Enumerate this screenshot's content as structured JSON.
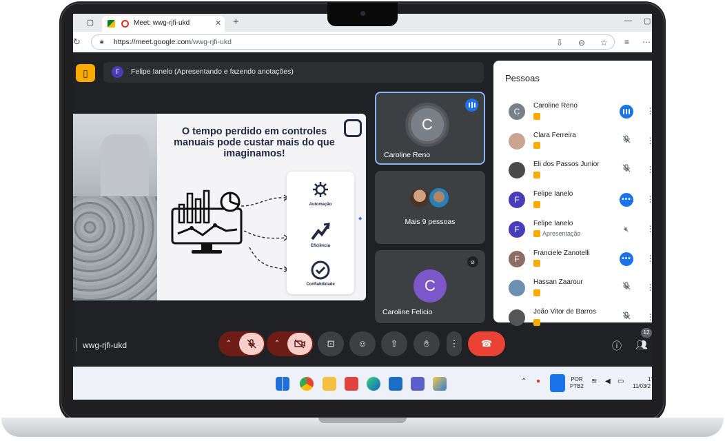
{
  "browser": {
    "tab_title": "Meet: wwg-rjfi-ukd",
    "url_host": "https://meet.google.com",
    "url_path": "/wwg-rjfi-ukd"
  },
  "meet": {
    "presenter_initial": "F",
    "presenter_text": "Felipe Ianelo (Apresentando e fazendo anotações)",
    "slide": {
      "title": "O tempo perdido em controles manuais pode custar mais do que imaginamos!",
      "items": [
        "Automação",
        "Eficiência",
        "Confiabilidade"
      ]
    },
    "tiles": [
      {
        "name": "Caroline Reno",
        "initial": "C",
        "color": "#7a8088"
      },
      {
        "name": "Mais 9 pessoas"
      },
      {
        "name": "Caroline Felicio",
        "initial": "C",
        "color": "#7b57c9"
      }
    ],
    "meeting_code": "wwg-rjfi-ukd",
    "people_count": "12"
  },
  "people_panel": {
    "title": "Pessoas",
    "people": [
      {
        "name": "Caroline Reno",
        "initial": "C",
        "color": "#7a8088",
        "sub": "",
        "state": "speaking"
      },
      {
        "name": "Clara Ferreira",
        "initial": "",
        "color": "#c8a491",
        "sub": "",
        "state": "muted"
      },
      {
        "name": "Eli dos Passos Junior",
        "initial": "",
        "color": "#4a4a4a",
        "sub": "",
        "state": "muted"
      },
      {
        "name": "Felipe Ianelo",
        "initial": "F",
        "color": "#4a3cb8",
        "sub": "",
        "state": "more"
      },
      {
        "name": "Felipe Ianelo",
        "initial": "F",
        "color": "#4a3cb8",
        "sub": "Apresentação",
        "state": "muted-speaker"
      },
      {
        "name": "Franciele Zanotelli",
        "initial": "F",
        "color": "#8d6e63",
        "sub": "",
        "state": "more"
      },
      {
        "name": "Hassan Zaarour",
        "initial": "",
        "color": "#6d8fb3",
        "sub": "",
        "state": "muted"
      },
      {
        "name": "João Vitor de Barros",
        "initial": "",
        "color": "#555",
        "sub": "",
        "state": "muted"
      }
    ]
  },
  "taskbar": {
    "lang_line1": "POR",
    "lang_line2": "PTB2",
    "time": "17",
    "date": "11/03/2"
  },
  "colors": {
    "meet_bg": "#202124",
    "tile_bg": "#3c4043",
    "accent_blue": "#1a73e8",
    "end_call": "#ea4335",
    "muted_red": "#6e1d16",
    "yellow": "#f9ab00"
  }
}
